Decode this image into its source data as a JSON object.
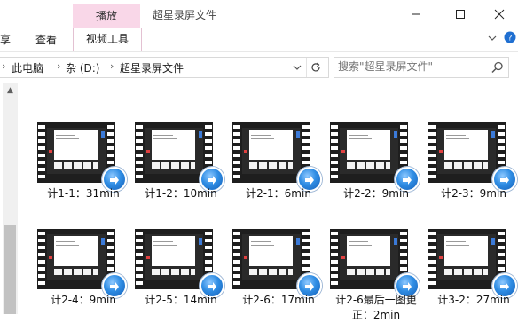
{
  "window": {
    "title": "超星录屏文件",
    "context_tab_group": "播放"
  },
  "ribbon": {
    "tabs": [
      {
        "label": "享"
      },
      {
        "label": "查看"
      },
      {
        "label": "视频工具"
      }
    ]
  },
  "address": {
    "crumbs": [
      {
        "label": "此电脑"
      },
      {
        "label": "杂 (D:)"
      },
      {
        "label": "超星录屏文件"
      }
    ]
  },
  "search": {
    "placeholder": "搜索\"超星录屏文件\""
  },
  "files": [
    {
      "label": "计1-1：31min"
    },
    {
      "label": "计1-2：10min"
    },
    {
      "label": "计2-1：6min"
    },
    {
      "label": "计2-2：9min"
    },
    {
      "label": "计2-3：9min"
    },
    {
      "label": "计2-4：9min"
    },
    {
      "label": "计2-5：14min"
    },
    {
      "label": "计2-6：17min"
    },
    {
      "label": "计2-6最后一图更正：2min"
    },
    {
      "label": "计3-2：27min"
    }
  ],
  "colors": {
    "context_tab": "#f9d7e8",
    "play_badge": "#2f8de4"
  }
}
